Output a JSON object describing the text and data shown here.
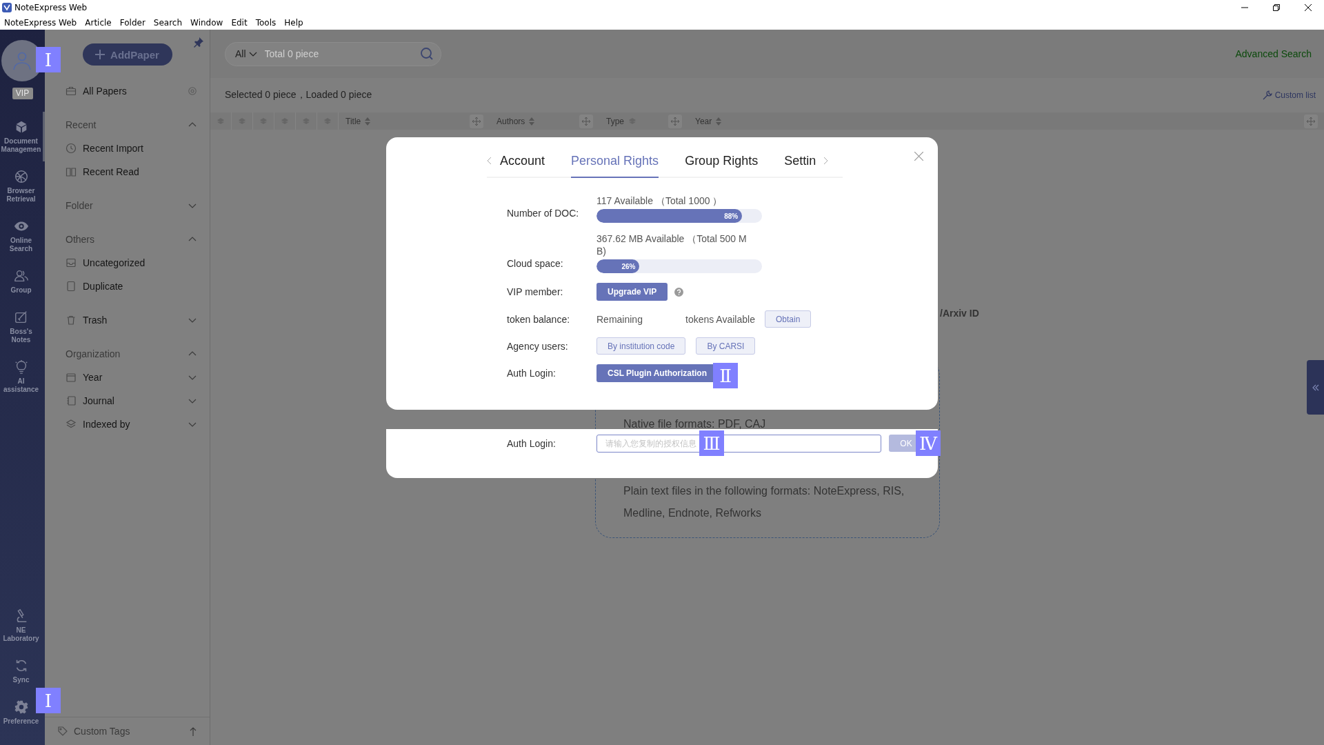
{
  "window": {
    "title": "NoteExpress Web"
  },
  "menu_bar": [
    "NoteExpress Web",
    "Article",
    "Folder",
    "Search",
    "Window",
    "Edit",
    "Tools",
    "Help"
  ],
  "nav_rail": {
    "vip_badge": "VIP",
    "items": [
      {
        "label": "Document Managemen",
        "selected": true
      },
      {
        "label": "Browser Retrieval",
        "selected": false
      },
      {
        "label": "Online Search",
        "selected": false
      },
      {
        "label": "Group",
        "selected": false
      },
      {
        "label": "Boss's Notes",
        "selected": false
      },
      {
        "label": "AI assistance",
        "selected": false
      }
    ],
    "bottom_items": [
      {
        "label": "NE Laboratory",
        "selected": false
      },
      {
        "label": "Sync",
        "selected": false
      },
      {
        "label": "Preference",
        "selected": false
      }
    ]
  },
  "sidebar": {
    "add_button": "AddPaper",
    "all_papers": "All Papers",
    "sections": [
      {
        "kind": "group",
        "title": "Recent",
        "expanded": true,
        "items": [
          {
            "label": "Recent Import"
          },
          {
            "label": "Recent Read"
          }
        ]
      },
      {
        "kind": "group",
        "title": "Folder",
        "expanded": false
      },
      {
        "kind": "group",
        "title": "Others",
        "expanded": true,
        "items": [
          {
            "label": "Uncategorized"
          },
          {
            "label": "Duplicate"
          }
        ]
      },
      {
        "kind": "entry",
        "title": "Trash",
        "expanded": false
      },
      {
        "kind": "group",
        "title": "Organization",
        "expanded": true,
        "items": [
          {
            "label": "Year",
            "expanded": false
          },
          {
            "label": "Journal",
            "expanded": false
          },
          {
            "label": "Indexed by",
            "expanded": false
          }
        ]
      }
    ],
    "footer": "Custom Tags"
  },
  "toolbar": {
    "scope": "All",
    "search": {
      "placeholder": "Total 0 piece"
    },
    "advanced_search": "Advanced Search"
  },
  "status": {
    "text": "Selected 0 piece，Loaded 0 piece",
    "custom_list": "Custom list"
  },
  "columns": [
    {
      "label": "Title"
    },
    {
      "label": "Authors"
    },
    {
      "label": "Type"
    },
    {
      "label": "Year"
    }
  ],
  "drop_zone": {
    "line_end": "/Arxiv ID",
    "native_formats": "Native file formats: PDF, CAJ",
    "text_formats": "Plain text files in the following formats: NoteExpress, RIS, Medline, Endnote, Refworks"
  },
  "dialog": {
    "tabs": [
      {
        "label": "Account",
        "selected": false
      },
      {
        "label": "Personal Rights",
        "selected": true
      },
      {
        "label": "Group Rights",
        "selected": false
      },
      {
        "label": "Settin",
        "selected": false
      }
    ],
    "rows": [
      {
        "kind": "meter",
        "label": "Number of DOC:",
        "caption": "117 Available （Total 1000 ）",
        "level": 0.88,
        "reading": "88%"
      },
      {
        "kind": "meter",
        "label": "Cloud space:",
        "caption": "367.62 MB Available （Total 500 MB)",
        "level": 0.26,
        "reading": "26%"
      },
      {
        "kind": "button_help",
        "label": "VIP member:",
        "button": "Upgrade VIP"
      },
      {
        "kind": "token",
        "label": "token balance:",
        "remaining": "Remaining",
        "available": "tokens Available",
        "button": "Obtain"
      },
      {
        "kind": "buttons",
        "label": "Agency users:",
        "buttons": [
          "By institution code",
          "By CARSI"
        ]
      },
      {
        "kind": "button",
        "label": "Auth Login:",
        "button": "CSL Plugin Authorization"
      }
    ]
  },
  "auth_panel": {
    "label": "Auth Login:",
    "input": {
      "placeholder": "请输入您复制的授权信息"
    },
    "ok": "OK",
    "ok_disabled": true
  },
  "markers": [
    "I",
    "I",
    "Ⅱ",
    "Ⅲ",
    "Ⅳ"
  ]
}
